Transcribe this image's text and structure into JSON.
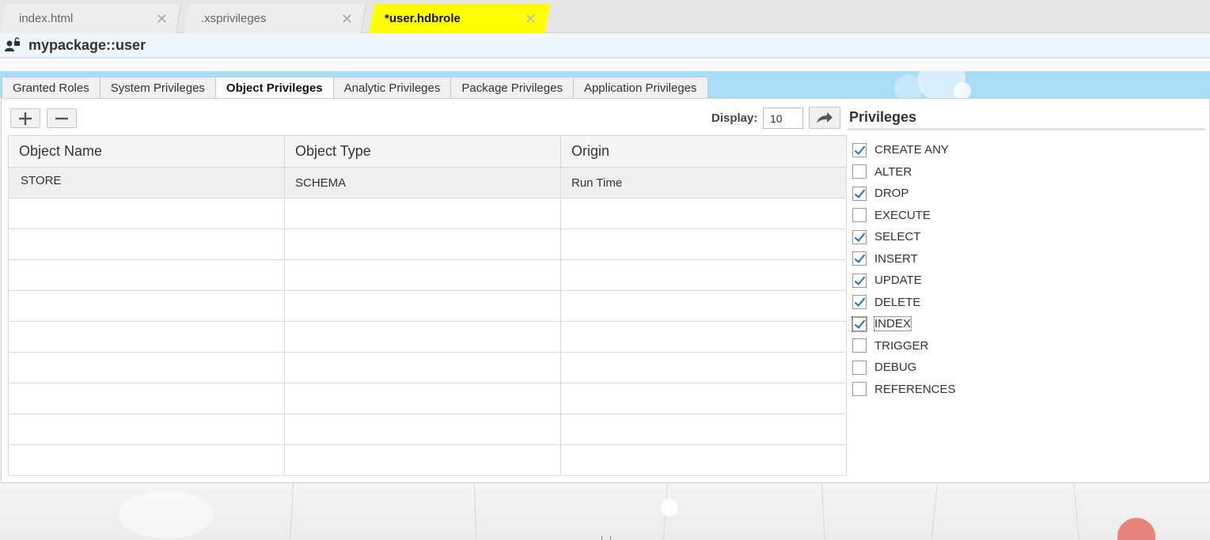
{
  "editor_tabs": [
    {
      "label": "index.html",
      "active": false
    },
    {
      "label": ".xsprivileges",
      "active": false
    },
    {
      "label": "*user.hdbrole",
      "active": true
    }
  ],
  "header": {
    "title": "mypackage::user",
    "icon": "user-lock-icon"
  },
  "sub_tabs": [
    {
      "label": "Granted Roles",
      "active": false
    },
    {
      "label": "System Privileges",
      "active": false
    },
    {
      "label": "Object Privileges",
      "active": true
    },
    {
      "label": "Analytic Privileges",
      "active": false
    },
    {
      "label": "Package Privileges",
      "active": false
    },
    {
      "label": "Application Privileges",
      "active": false
    }
  ],
  "toolbar": {
    "add_icon": "plus-icon",
    "remove_icon": "minus-icon",
    "display_label": "Display:",
    "display_value": "10",
    "go_icon": "share-arrow-icon"
  },
  "table": {
    "columns": [
      "Object Name",
      "Object Type",
      "Origin"
    ],
    "rows": [
      [
        "STORE",
        "SCHEMA",
        "Run Time"
      ],
      [
        "",
        "",
        ""
      ],
      [
        "",
        "",
        ""
      ],
      [
        "",
        "",
        ""
      ],
      [
        "",
        "",
        ""
      ],
      [
        "",
        "",
        ""
      ],
      [
        "",
        "",
        ""
      ],
      [
        "",
        "",
        ""
      ],
      [
        "",
        "",
        ""
      ],
      [
        "",
        "",
        ""
      ]
    ]
  },
  "privileges": {
    "title": "Privileges",
    "items": [
      {
        "label": "CREATE ANY",
        "checked": true
      },
      {
        "label": "ALTER",
        "checked": false
      },
      {
        "label": "DROP",
        "checked": true
      },
      {
        "label": "EXECUTE",
        "checked": false
      },
      {
        "label": "SELECT",
        "checked": true
      },
      {
        "label": "INSERT",
        "checked": true
      },
      {
        "label": "UPDATE",
        "checked": true
      },
      {
        "label": "DELETE",
        "checked": true
      },
      {
        "label": "INDEX",
        "checked": true,
        "focused": true
      },
      {
        "label": "TRIGGER",
        "checked": false
      },
      {
        "label": "DEBUG",
        "checked": false
      },
      {
        "label": "REFERENCES",
        "checked": false
      }
    ]
  },
  "colors": {
    "active_tab": "#ffff00",
    "tab_strip": "#a8dcf7",
    "check": "#1a75bc"
  }
}
